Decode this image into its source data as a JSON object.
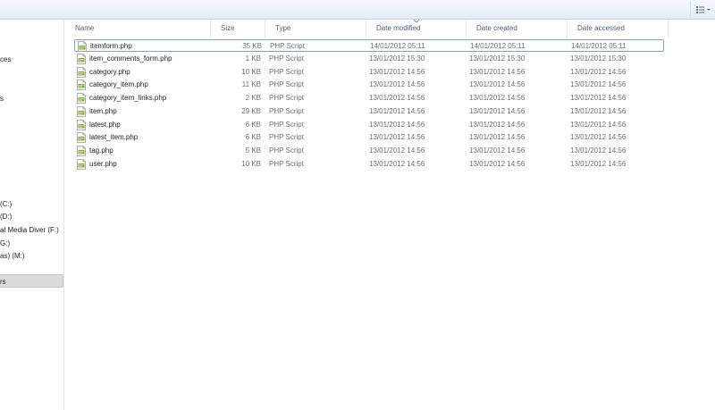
{
  "columns": {
    "name": "Name",
    "size": "Size",
    "type": "Type",
    "modified": "Date modified",
    "created": "Date created",
    "accessed": "Date accessed"
  },
  "nav": [
    "ces",
    "s",
    "(C:)",
    "(D:)",
    "al Media Diver (F:)",
    "G:)",
    "as) (M:)",
    "rs"
  ],
  "files": [
    {
      "name": "itemform.php",
      "size": "35 KB",
      "type": "PHP Script",
      "modified": "14/01/2012 05:11",
      "created": "14/01/2012 05:11",
      "accessed": "14/01/2012 05:11"
    },
    {
      "name": "item_comments_form.php",
      "size": "1 KB",
      "type": "PHP Script",
      "modified": "13/01/2012 15:30",
      "created": "13/01/2012 15:30",
      "accessed": "13/01/2012 15:30"
    },
    {
      "name": "category.php",
      "size": "10 KB",
      "type": "PHP Script",
      "modified": "13/01/2012 14:56",
      "created": "13/01/2012 14:56",
      "accessed": "13/01/2012 14:56"
    },
    {
      "name": "category_item.php",
      "size": "11 KB",
      "type": "PHP Script",
      "modified": "13/01/2012 14:56",
      "created": "13/01/2012 14:56",
      "accessed": "13/01/2012 14:56"
    },
    {
      "name": "category_item_links.php",
      "size": "2 KB",
      "type": "PHP Script",
      "modified": "13/01/2012 14:56",
      "created": "13/01/2012 14:56",
      "accessed": "13/01/2012 14:56"
    },
    {
      "name": "item.php",
      "size": "29 KB",
      "type": "PHP Script",
      "modified": "13/01/2012 14:56",
      "created": "13/01/2012 14:56",
      "accessed": "13/01/2012 14:56"
    },
    {
      "name": "latest.php",
      "size": "6 KB",
      "type": "PHP Script",
      "modified": "13/01/2012 14:56",
      "created": "13/01/2012 14:56",
      "accessed": "13/01/2012 14:56"
    },
    {
      "name": "latest_item.php",
      "size": "6 KB",
      "type": "PHP Script",
      "modified": "13/01/2012 14:56",
      "created": "13/01/2012 14:56",
      "accessed": "13/01/2012 14:56"
    },
    {
      "name": "tag.php",
      "size": "5 KB",
      "type": "PHP Script",
      "modified": "13/01/2012 14:56",
      "created": "13/01/2012 14:56",
      "accessed": "13/01/2012 14:56"
    },
    {
      "name": "user.php",
      "size": "10 KB",
      "type": "PHP Script",
      "modified": "13/01/2012 14:56",
      "created": "13/01/2012 14:56",
      "accessed": "13/01/2012 14:56"
    }
  ],
  "icons": {
    "view_toggle": "details-view-icon",
    "file": "php-file-icon",
    "sort": "sort-down-icon"
  },
  "colors": {
    "header_text": "#4c607a",
    "focus_border": "#7da2ce",
    "selected_nav": "#dadada"
  }
}
